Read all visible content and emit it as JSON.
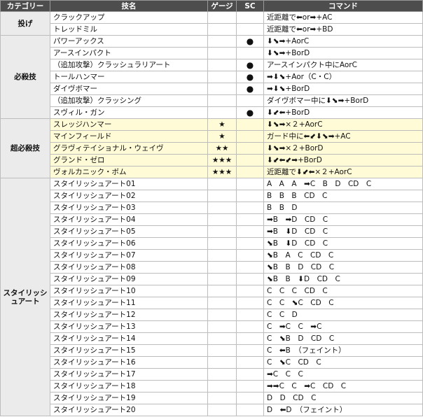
{
  "headers": [
    "カテゴリー",
    "技名",
    "ゲージ",
    "SC",
    "コマンド"
  ],
  "groups": [
    {
      "category": "投げ",
      "super": false,
      "rows": [
        {
          "name": "クラックアップ",
          "gauge": "",
          "sc": "",
          "command": "近距離で⬅or➡+AC"
        },
        {
          "name": "トレッドミル",
          "gauge": "",
          "sc": "",
          "command": "近距離で⬅or➡+BD"
        }
      ]
    },
    {
      "category": "必殺技",
      "super": false,
      "rows": [
        {
          "name": "パワーアックス",
          "gauge": "",
          "sc": "●",
          "command": "⬇⬊➡+AorC"
        },
        {
          "name": "アースインパクト",
          "gauge": "",
          "sc": "",
          "command": "⬇⬊➡+BorD"
        },
        {
          "name": "（追加攻撃）クラッシュラリアート",
          "gauge": "",
          "sc": "●",
          "command": "アースインパクト中にAorC"
        },
        {
          "name": "トールハンマー",
          "gauge": "",
          "sc": "●",
          "command": "➡⬇⬊+Aor（C・C）"
        },
        {
          "name": "ダイヴボマー",
          "gauge": "",
          "sc": "●",
          "command": "➡⬇⬊+BorD"
        },
        {
          "name": "（追加攻撃）クラッシング",
          "gauge": "",
          "sc": "",
          "command": "ダイヴボマー中に⬇⬊➡+BorD"
        },
        {
          "name": "スヴィル・ガン",
          "gauge": "",
          "sc": "●",
          "command": "⬇⬋⬅+BorD"
        }
      ]
    },
    {
      "category": "超必殺技",
      "super": true,
      "rows": [
        {
          "name": "スレッジハンマー",
          "gauge": "★",
          "sc": "",
          "command": "⬇⬊➡×２+AorC"
        },
        {
          "name": "マインフィールド",
          "gauge": "★",
          "sc": "",
          "command": "ガード中に⬅⬋⬇⬊➡+AC"
        },
        {
          "name": "グラヴィテイショナル・ウェイヴ",
          "gauge": "★★",
          "sc": "",
          "command": "⬇⬊➡×２+BorD"
        },
        {
          "name": "グランド・ゼロ",
          "gauge": "★★★",
          "sc": "",
          "command": "⬇⬋⬅⬋➡+BorD"
        },
        {
          "name": "ヴォルカニック・ボム",
          "gauge": "★★★",
          "sc": "",
          "command": "近距離で⬇⬋⬅×２+AorC"
        }
      ]
    },
    {
      "category": "スタイリッシュアート",
      "super": false,
      "rows": [
        {
          "name": "スタイリッシュアート01",
          "gauge": "",
          "sc": "",
          "command": "A　A　A　➡C　B　D　CD　C"
        },
        {
          "name": "スタイリッシュアート02",
          "gauge": "",
          "sc": "",
          "command": "B　B　B　CD　C"
        },
        {
          "name": "スタイリッシュアート03",
          "gauge": "",
          "sc": "",
          "command": "B　B　D"
        },
        {
          "name": "スタイリッシュアート04",
          "gauge": "",
          "sc": "",
          "command": "➡B　➡D　CD　C"
        },
        {
          "name": "スタイリッシュアート05",
          "gauge": "",
          "sc": "",
          "command": "➡B　⬇D　CD　C"
        },
        {
          "name": "スタイリッシュアート06",
          "gauge": "",
          "sc": "",
          "command": "⬊B　⬇D　CD　C"
        },
        {
          "name": "スタイリッシュアート07",
          "gauge": "",
          "sc": "",
          "command": "⬊B　A　C　CD　C"
        },
        {
          "name": "スタイリッシュアート08",
          "gauge": "",
          "sc": "",
          "command": "⬊B　B　D　CD　C"
        },
        {
          "name": "スタイリッシュアート09",
          "gauge": "",
          "sc": "",
          "command": "⬊B　B　⬇D　CD　C"
        },
        {
          "name": "スタイリッシュアート10",
          "gauge": "",
          "sc": "",
          "command": "C　C　C　CD　C"
        },
        {
          "name": "スタイリッシュアート11",
          "gauge": "",
          "sc": "",
          "command": "C　C　⬊C　CD　C"
        },
        {
          "name": "スタイリッシュアート12",
          "gauge": "",
          "sc": "",
          "command": "C　C　D"
        },
        {
          "name": "スタイリッシュアート13",
          "gauge": "",
          "sc": "",
          "command": "C　➡C　C　➡C"
        },
        {
          "name": "スタイリッシュアート14",
          "gauge": "",
          "sc": "",
          "command": "C　⬊B　D　CD　C"
        },
        {
          "name": "スタイリッシュアート15",
          "gauge": "",
          "sc": "",
          "command": "C　⬅B　（フェイント）"
        },
        {
          "name": "スタイリッシュアート16",
          "gauge": "",
          "sc": "",
          "command": "C　⬊C　CD　C"
        },
        {
          "name": "スタイリッシュアート17",
          "gauge": "",
          "sc": "",
          "command": "➡C　C　C"
        },
        {
          "name": "スタイリッシュアート18",
          "gauge": "",
          "sc": "",
          "command": "➡➡C　C　➡C　CD　C"
        },
        {
          "name": "スタイリッシュアート19",
          "gauge": "",
          "sc": "",
          "command": "D　D　CD　C"
        },
        {
          "name": "スタイリッシュアート20",
          "gauge": "",
          "sc": "",
          "command": "D　⬅D　（フェイント）"
        }
      ]
    }
  ]
}
